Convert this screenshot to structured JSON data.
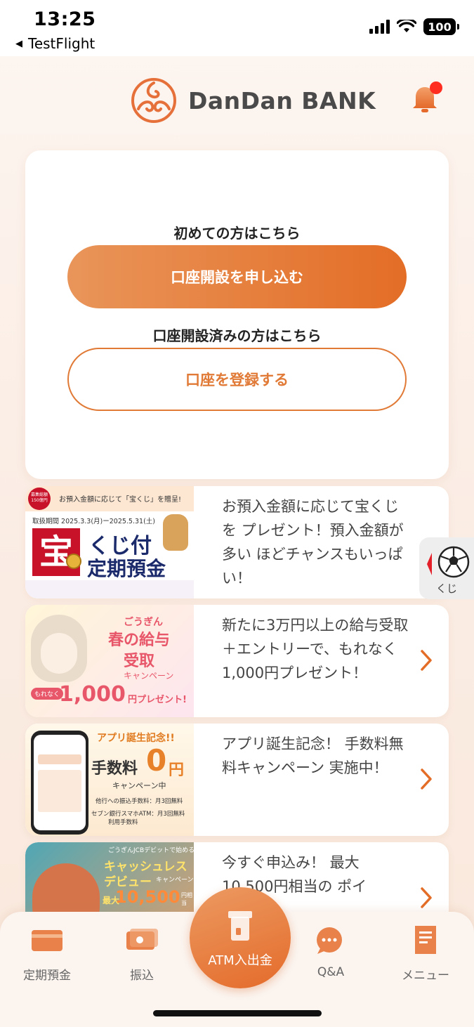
{
  "status_bar": {
    "time": "13:25",
    "back_app": "TestFlight",
    "battery": "100"
  },
  "header": {
    "logo_text": "DanDan BANK",
    "bell_badge_color": "#ff2d1f"
  },
  "account_card": {
    "first_time_label": "初めての方はこちら",
    "open_account_button": "口座開設を申し込む",
    "existing_label": "口座開設済みの方はこちら",
    "register_button": "口座を登録する"
  },
  "promos": [
    {
      "text": "お預入金額に応じて宝くじを プレゼント！預入金額が多い ほどチャンスもいっぱい！",
      "banner": {
        "badge": "募集総額150億円",
        "top": "お預入金額に応じて「宝くじ」を贈呈!",
        "period": "取扱期間 2025.3.3(月)ー2025.5.31(土)",
        "big": "宝",
        "line1": "くじ付",
        "line2": "定期預金"
      }
    },
    {
      "text": "新たに3万円以上の給与受取 ＋エントリーで、もれなく 1,000円プレゼント！",
      "banner": {
        "l1": "ごうぎん",
        "l2": "春の給与",
        "l3": "受取",
        "l4": "キャンペーン",
        "tag": "もれなく",
        "amount": "1,000",
        "suffix": "円プレゼント!"
      }
    },
    {
      "text": "アプリ誕生記念！ 手数料無料キャンペーン 実施中！",
      "banner": {
        "title": "アプリ誕生記念!!",
        "fee": "手数料",
        "zero": "0",
        "yen": "円",
        "sub": "キャンペーン中",
        "note1": "他行への振込手数料：月3回無料",
        "note2": "セブン銀行スマホATM：月3回無料",
        "note3": "利用手数料"
      }
    },
    {
      "text": "今すぐ申込み！ 最大 10,500円相当の ポイ",
      "banner": {
        "l1": "ごうぎんJCBデビットで始める",
        "l2": "キャッシュレス",
        "l3": "デビュー",
        "l3b": "キャンペーン",
        "l4": "最大",
        "amount": "10,500",
        "yen": "円相当"
      }
    }
  ],
  "kuji": {
    "label": "くじ"
  },
  "nav": {
    "items": [
      {
        "label": "定期預金",
        "icon": "card-icon"
      },
      {
        "label": "振込",
        "icon": "transfer-icon"
      },
      {
        "label": "ATM入出金",
        "icon": "atm-icon"
      },
      {
        "label": "Q&A",
        "icon": "chat-icon"
      },
      {
        "label": "メニュー",
        "icon": "menu-doc-icon"
      }
    ]
  },
  "colors": {
    "accent": "#e36d26",
    "accent_light": "#e9955a",
    "nav_icon": "#e8824a"
  }
}
